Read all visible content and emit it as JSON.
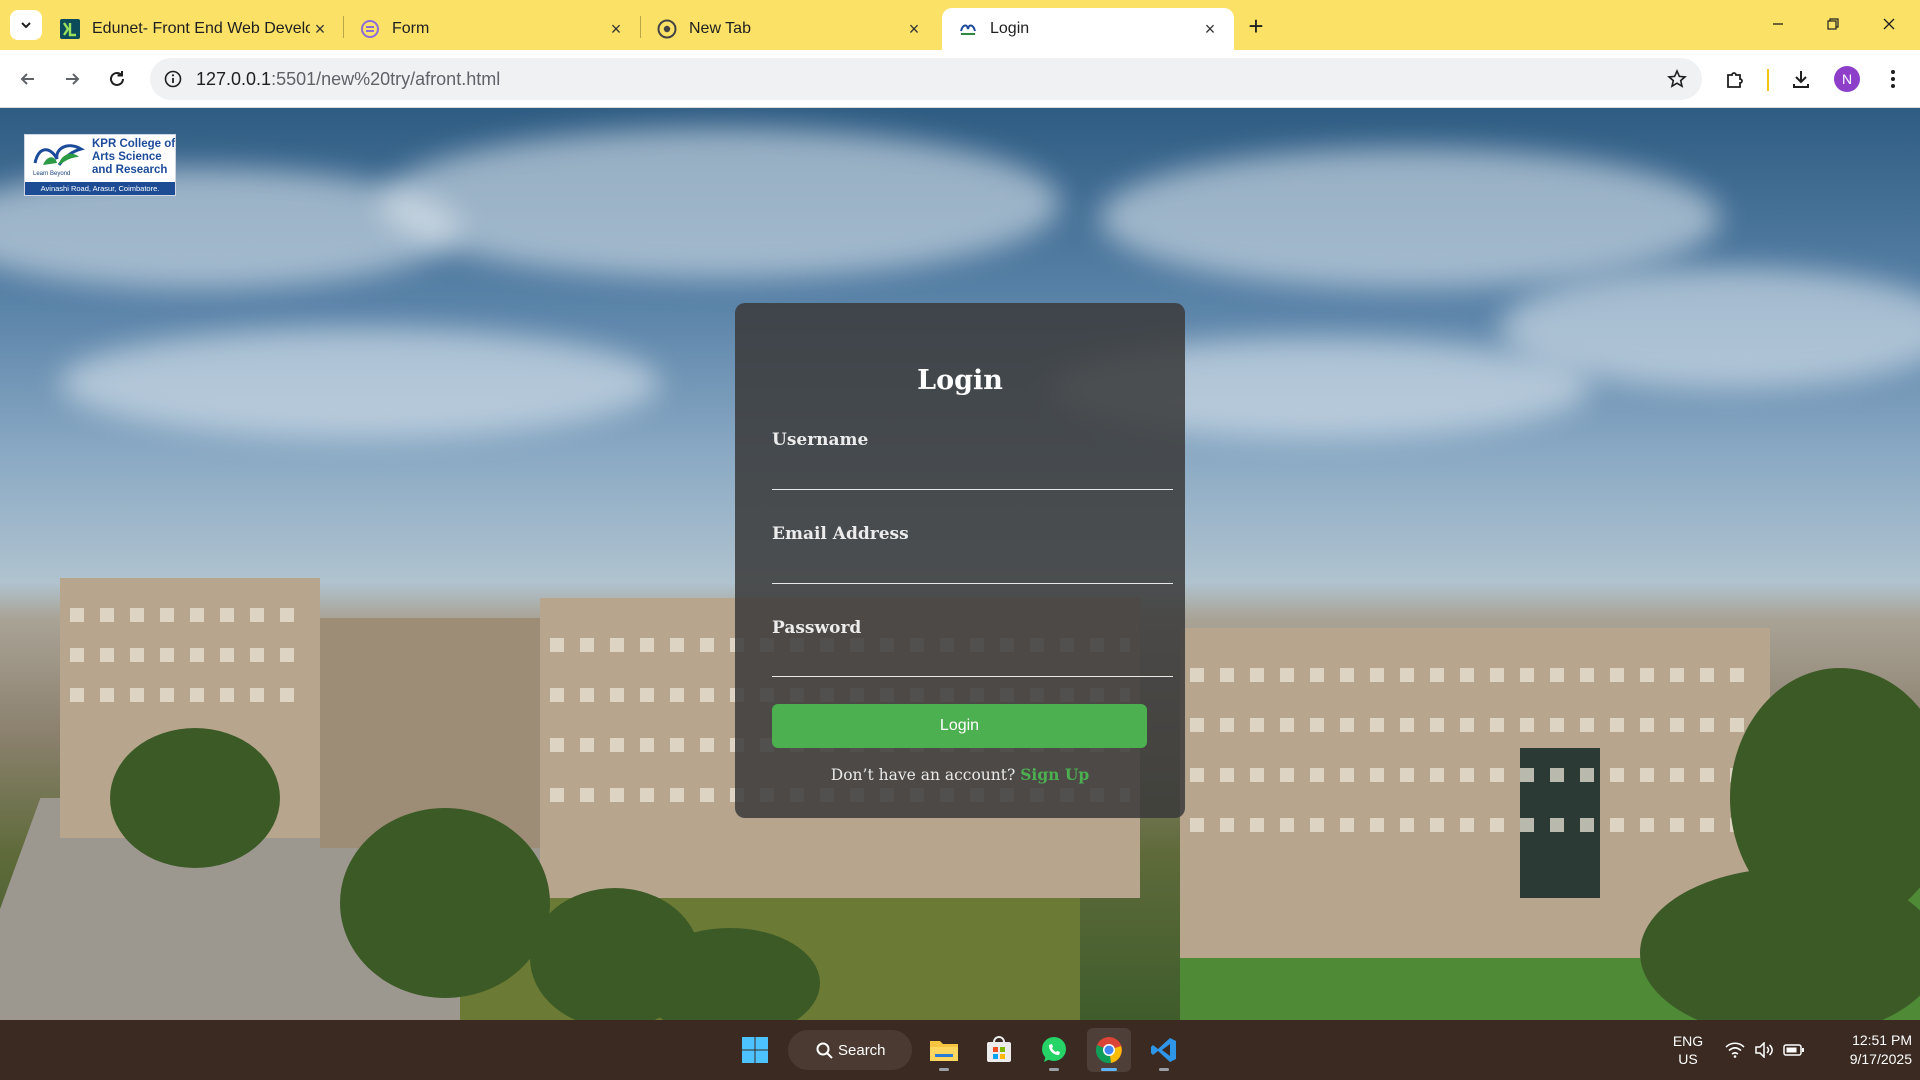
{
  "browser": {
    "tabs": [
      {
        "title": "Edunet- Front End Web Develop",
        "favicon": "edunet-logo-icon"
      },
      {
        "title": "Form",
        "favicon": "form-app-icon"
      },
      {
        "title": "New Tab",
        "favicon": "chrome-icon"
      },
      {
        "title": "Login",
        "favicon": "college-logo-icon",
        "active": true
      }
    ],
    "url_host": "127.0.0.1",
    "url_path": ":5501/new%20try/afront.html",
    "profile_initial": "N",
    "colors": {
      "tab_strip": "#fbe267",
      "profile": "#8e3fc9"
    }
  },
  "page": {
    "logo": {
      "name_lines": [
        "KPR College of",
        "Arts Science",
        "and Research"
      ],
      "tagline": "Learn Beyond",
      "address": "Avinashi Road, Arasur, Coimbatore."
    },
    "login": {
      "title": "Login",
      "username_label": "Username",
      "email_label": "Email Address",
      "password_label": "Password",
      "button_label": "Login",
      "signup_prompt": "Don’t have an account?",
      "signup_link": "Sign Up",
      "accent_color": "#4caf50"
    }
  },
  "taskbar": {
    "search_label": "Search",
    "apps": [
      "start-icon",
      "file-explorer-icon",
      "microsoft-store-icon",
      "whatsapp-icon",
      "chrome-icon",
      "vscode-icon"
    ],
    "language_line1": "ENG",
    "language_line2": "US",
    "time": "12:51 PM",
    "date": "9/17/2025"
  }
}
